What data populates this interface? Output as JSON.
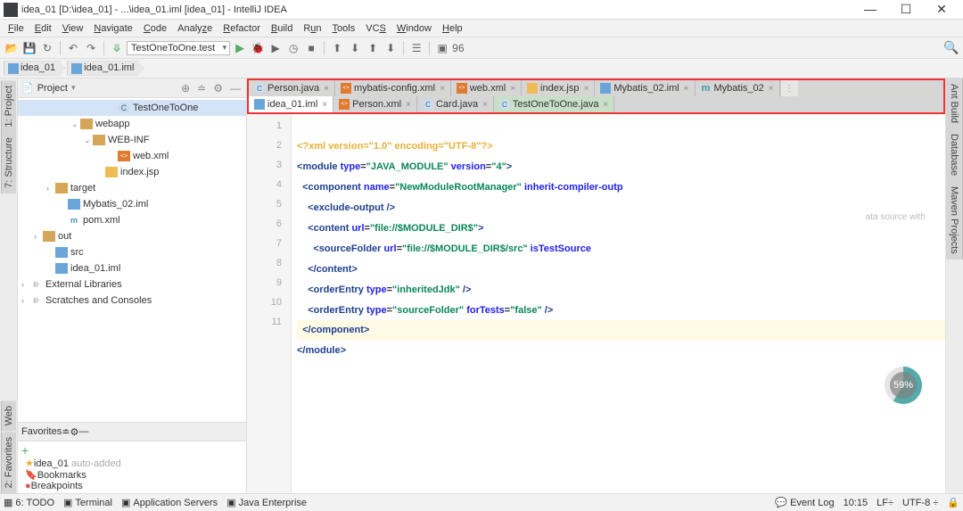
{
  "titlebar": {
    "title": "idea_01 [D:\\idea_01] - ...\\idea_01.iml [idea_01] - IntelliJ IDEA"
  },
  "menu": [
    "File",
    "Edit",
    "View",
    "Navigate",
    "Code",
    "Analyze",
    "Refactor",
    "Build",
    "Run",
    "Tools",
    "VCS",
    "Window",
    "Help"
  ],
  "toolbar": {
    "run_config": "TestOneToOne.test",
    "extra": "96"
  },
  "breadcrumb": [
    "idea_01",
    "idea_01.iml"
  ],
  "projectpanel": {
    "title": "Project",
    "nodes": [
      {
        "indent": 7,
        "icon": "cfile",
        "label": "TestOneToOne",
        "sel": true
      },
      {
        "indent": 4,
        "arrow": "v",
        "icon": "folder",
        "label": "webapp"
      },
      {
        "indent": 5,
        "arrow": "v",
        "icon": "folder",
        "label": "WEB-INF"
      },
      {
        "indent": 7,
        "icon": "xml",
        "label": "web.xml"
      },
      {
        "indent": 6,
        "icon": "jsp",
        "label": "index.jsp"
      },
      {
        "indent": 2,
        "arrow": ">",
        "icon": "folder",
        "label": "target"
      },
      {
        "indent": 3,
        "icon": "iml",
        "label": "Mybatis_02.iml"
      },
      {
        "indent": 3,
        "icon": "m",
        "label": "pom.xml"
      },
      {
        "indent": 1,
        "arrow": ">",
        "icon": "folder",
        "label": "out"
      },
      {
        "indent": 2,
        "icon": "folder blue",
        "label": "src"
      },
      {
        "indent": 2,
        "icon": "iml",
        "label": "idea_01.iml"
      },
      {
        "indent": 0,
        "arrow": ">",
        "icon": "lib",
        "label": "External Libraries"
      },
      {
        "indent": 0,
        "arrow": ">",
        "icon": "lib",
        "label": "Scratches and Consoles"
      }
    ]
  },
  "favorites": {
    "title": "Favorites",
    "items": [
      {
        "icon": "star",
        "label": "idea_01",
        "extra": "auto-added"
      },
      {
        "icon": "bookmark",
        "label": "Bookmarks"
      },
      {
        "icon": "breakpoint",
        "label": "Breakpoints"
      }
    ]
  },
  "editor": {
    "tabs_row1": [
      {
        "icon": "cfile",
        "label": "Person.java"
      },
      {
        "icon": "xml",
        "label": "mybatis-config.xml"
      },
      {
        "icon": "xml",
        "label": "web.xml"
      },
      {
        "icon": "jsp",
        "label": "index.jsp"
      },
      {
        "icon": "iml",
        "label": "Mybatis_02.iml"
      },
      {
        "icon": "m",
        "label": "Mybatis_02"
      }
    ],
    "tabs_row2": [
      {
        "icon": "iml",
        "label": "idea_01.iml",
        "active": true
      },
      {
        "icon": "xml",
        "label": "Person.xml"
      },
      {
        "icon": "cfile",
        "label": "Card.java"
      },
      {
        "icon": "cfile",
        "label": "TestOneToOne.java",
        "modified": true
      }
    ],
    "lines": [
      "1",
      "2",
      "3",
      "4",
      "5",
      "6",
      "7",
      "8",
      "9",
      "10",
      "11"
    ]
  },
  "code": {
    "l1": {
      "a": "<?",
      "b": "xml version",
      "c": "=\"1.0\" ",
      "d": "encoding",
      "e": "=\"UTF-8\"",
      "f": "?>"
    },
    "l2": {
      "a": "<",
      "b": "module ",
      "c": "type",
      "d": "=",
      "e": "\"JAVA_MODULE\" ",
      "f": "version",
      "g": "=",
      "h": "\"4\"",
      "i": ">"
    },
    "l3": {
      "a": "  <",
      "b": "component ",
      "c": "name",
      "d": "=",
      "e": "\"NewModuleRootManager\" ",
      "f": "inherit-compiler-outp"
    },
    "l4": {
      "a": "    <",
      "b": "exclude-output ",
      "c": "/>"
    },
    "l5": {
      "a": "    <",
      "b": "content ",
      "c": "url",
      "d": "=",
      "e": "\"file://$MODULE_DIR$\"",
      "f": ">"
    },
    "l6": {
      "a": "      <",
      "b": "sourceFolder ",
      "c": "url",
      "d": "=",
      "e": "\"file://$MODULE_DIR$/src\" ",
      "f": "isTestSource"
    },
    "l7": {
      "a": "    </",
      "b": "content",
      "c": ">"
    },
    "l8": {
      "a": "    <",
      "b": "orderEntry ",
      "c": "type",
      "d": "=",
      "e": "\"inheritedJdk\" ",
      "f": "/>"
    },
    "l9": {
      "a": "    <",
      "b": "orderEntry ",
      "c": "type",
      "d": "=",
      "e": "\"sourceFolder\" ",
      "f": "forTests",
      "g": "=",
      "h": "\"false\" ",
      "i": "/>"
    },
    "l10": {
      "a": "  </",
      "b": "component",
      "c": ">"
    },
    "l11": {
      "a": "</",
      "b": "module",
      "c": ">"
    }
  },
  "progress": "59%",
  "right_tabs": [
    "Ant Build",
    "Database",
    "Maven Projects"
  ],
  "status": {
    "todo": "6: TODO",
    "terminal": "Terminal",
    "appservers": "Application Servers",
    "javae": "Java Enterprise",
    "eventlog": "Event Log",
    "pos": "10:15",
    "lf": "LF÷",
    "enc": "UTF-8 ÷"
  },
  "left_tabs": [
    "1: Project",
    "7: Structure",
    "Web",
    "2: Favorites"
  ],
  "hint": "ata source with"
}
